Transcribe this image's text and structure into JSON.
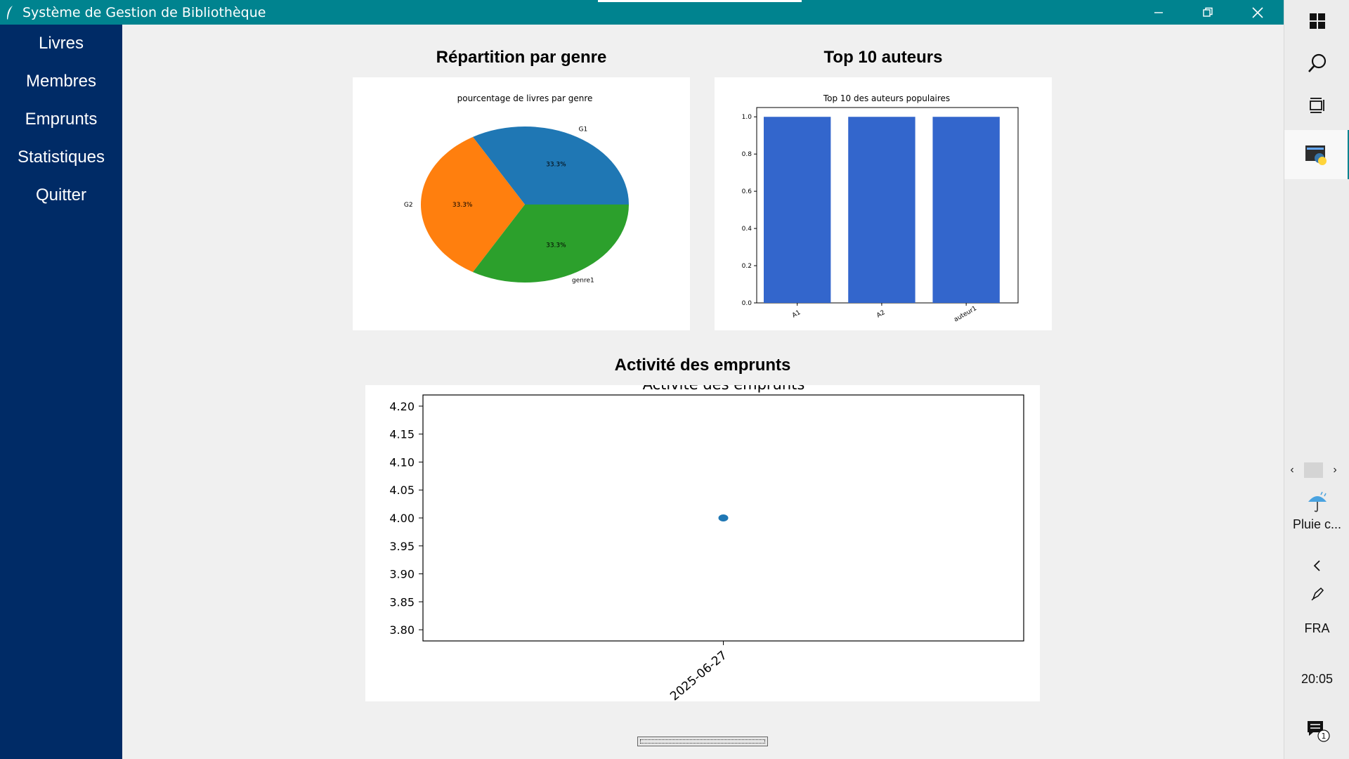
{
  "window": {
    "title": "Système de Gestion de Bibliothèque"
  },
  "sidebar": {
    "items": [
      {
        "label": "Livres"
      },
      {
        "label": "Membres"
      },
      {
        "label": "Emprunts"
      },
      {
        "label": "Statistiques"
      },
      {
        "label": "Quitter"
      }
    ]
  },
  "sections": {
    "genre_title": "Répartition par genre",
    "authors_title": "Top 10 auteurs",
    "activity_title": "Activité des emprunts"
  },
  "chart_data": [
    {
      "type": "pie",
      "title": "pourcentage de livres par genre",
      "labels": [
        "G1",
        "G2",
        "genre1"
      ],
      "values": [
        33.3,
        33.3,
        33.3
      ],
      "pct_labels": [
        "33.3%",
        "33.3%",
        "33.3%"
      ],
      "colors": [
        "#1f77b4",
        "#ff7f0e",
        "#2ca02c"
      ]
    },
    {
      "type": "bar",
      "title": "Top 10 des auteurs populaires",
      "categories": [
        "A1",
        "A2",
        "auteur1"
      ],
      "values": [
        1,
        1,
        1
      ],
      "ylim": [
        0,
        1.05
      ],
      "yticks": [
        "0.0",
        "0.2",
        "0.4",
        "0.6",
        "0.8",
        "1.0"
      ],
      "color": "#3366cc"
    },
    {
      "type": "scatter",
      "title": "Activité des emprunts",
      "x": [
        "2025-06-27"
      ],
      "y": [
        4
      ],
      "ylim": [
        3.78,
        4.22
      ],
      "yticks": [
        "3.80",
        "3.85",
        "3.90",
        "3.95",
        "4.00",
        "4.05",
        "4.10",
        "4.15",
        "4.20"
      ],
      "color": "#1f77b4"
    }
  ],
  "taskbar": {
    "weather_label": "Pluie c...",
    "language": "FRA",
    "time": "20:05",
    "notification_count": "1"
  }
}
